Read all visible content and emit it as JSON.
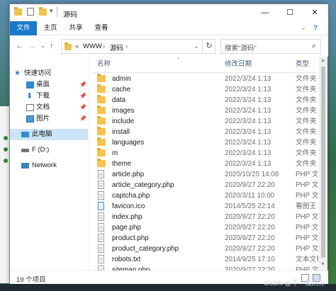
{
  "window": {
    "title": "源码",
    "controls": {
      "minimize": "—",
      "maximize": "☐",
      "close": "✕"
    }
  },
  "ribbon": {
    "tabs": [
      "文件",
      "主页",
      "共享",
      "查看"
    ],
    "help": "?"
  },
  "nav": {
    "back": "←",
    "forward": "→",
    "recent": "⌄",
    "up": "↑",
    "breadcrumb_sep": "«",
    "path": [
      "WWW",
      "源码"
    ],
    "sep": "›",
    "dropdown": "⌄",
    "refresh": "↻",
    "search_placeholder": "搜索\"源码\"",
    "search_icon": "⌕"
  },
  "navpane": {
    "quick_access": "快速访问",
    "items": [
      {
        "label": "桌面"
      },
      {
        "label": "下载"
      },
      {
        "label": "文档"
      },
      {
        "label": "图片"
      }
    ],
    "pin": "📌",
    "this_pc": "此电脑",
    "drive": "F (D:)",
    "network": "Network"
  },
  "columns": {
    "name": "名称",
    "date": "修改日期",
    "type": "类型",
    "sort_indicator": "^"
  },
  "files": [
    {
      "name": "admin",
      "date": "2022/3/24 1:13",
      "type": "文件夹",
      "kind": "folder"
    },
    {
      "name": "cache",
      "date": "2022/3/24 1:13",
      "type": "文件夹",
      "kind": "folder"
    },
    {
      "name": "data",
      "date": "2022/3/24 1:13",
      "type": "文件夹",
      "kind": "folder"
    },
    {
      "name": "images",
      "date": "2022/3/24 1:13",
      "type": "文件夹",
      "kind": "folder"
    },
    {
      "name": "include",
      "date": "2022/3/24 1:13",
      "type": "文件夹",
      "kind": "folder"
    },
    {
      "name": "install",
      "date": "2022/3/24 1:13",
      "type": "文件夹",
      "kind": "folder"
    },
    {
      "name": "languages",
      "date": "2022/3/24 1:13",
      "type": "文件夹",
      "kind": "folder"
    },
    {
      "name": "m",
      "date": "2022/3/24 1:13",
      "type": "文件夹",
      "kind": "folder"
    },
    {
      "name": "theme",
      "date": "2022/3/24 1:13",
      "type": "文件夹",
      "kind": "folder"
    },
    {
      "name": "article.php",
      "date": "2020/10/25 14:06",
      "type": "PHP 文件",
      "kind": "file"
    },
    {
      "name": "article_category.php",
      "date": "2020/9/27 22:20",
      "type": "PHP 文件",
      "kind": "file"
    },
    {
      "name": "captcha.php",
      "date": "2020/3/11 10:00",
      "type": "PHP 文件",
      "kind": "file"
    },
    {
      "name": "favicon.ico",
      "date": "2014/5/25 22:14",
      "type": "看图王",
      "kind": "ico"
    },
    {
      "name": "index.php",
      "date": "2020/9/27 22:20",
      "type": "PHP 文件",
      "kind": "file"
    },
    {
      "name": "page.php",
      "date": "2020/9/27 22:20",
      "type": "PHP 文件",
      "kind": "file"
    },
    {
      "name": "product.php",
      "date": "2020/9/27 22:20",
      "type": "PHP 文件",
      "kind": "file"
    },
    {
      "name": "product_category.php",
      "date": "2020/9/27 22:20",
      "type": "PHP 文件",
      "kind": "file"
    },
    {
      "name": "robots.txt",
      "date": "2014/9/25 17:10",
      "type": "文本文档",
      "kind": "file"
    },
    {
      "name": "sitemap.php",
      "date": "2020/9/27 22:20",
      "type": "PHP 文件",
      "kind": "file"
    }
  ],
  "status": {
    "count": "19 个项目"
  },
  "watermark": "CSDN @不一般的你"
}
